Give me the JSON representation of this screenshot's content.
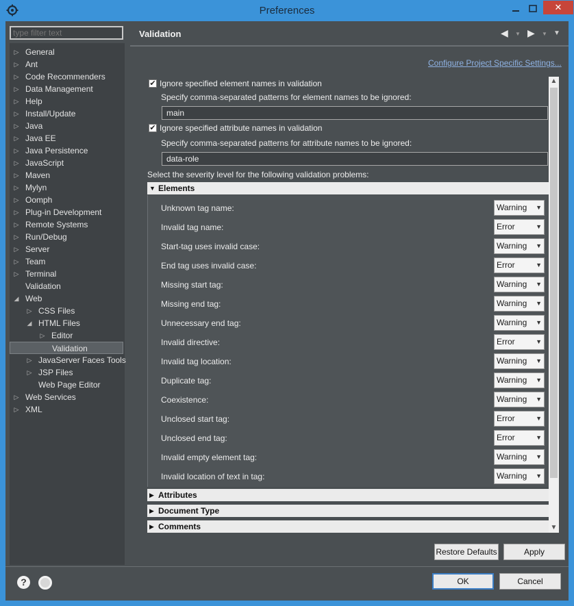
{
  "window": {
    "title": "Preferences",
    "close_glyph": "✕"
  },
  "filter": {
    "placeholder": "type filter text"
  },
  "tree": [
    {
      "label": "General",
      "depth": 0,
      "arrow": "collapsed"
    },
    {
      "label": "Ant",
      "depth": 0,
      "arrow": "collapsed"
    },
    {
      "label": "Code Recommenders",
      "depth": 0,
      "arrow": "collapsed"
    },
    {
      "label": "Data Management",
      "depth": 0,
      "arrow": "collapsed"
    },
    {
      "label": "Help",
      "depth": 0,
      "arrow": "collapsed"
    },
    {
      "label": "Install/Update",
      "depth": 0,
      "arrow": "collapsed"
    },
    {
      "label": "Java",
      "depth": 0,
      "arrow": "collapsed"
    },
    {
      "label": "Java EE",
      "depth": 0,
      "arrow": "collapsed"
    },
    {
      "label": "Java Persistence",
      "depth": 0,
      "arrow": "collapsed"
    },
    {
      "label": "JavaScript",
      "depth": 0,
      "arrow": "collapsed"
    },
    {
      "label": "Maven",
      "depth": 0,
      "arrow": "collapsed"
    },
    {
      "label": "Mylyn",
      "depth": 0,
      "arrow": "collapsed"
    },
    {
      "label": "Oomph",
      "depth": 0,
      "arrow": "collapsed"
    },
    {
      "label": "Plug-in Development",
      "depth": 0,
      "arrow": "collapsed"
    },
    {
      "label": "Remote Systems",
      "depth": 0,
      "arrow": "collapsed"
    },
    {
      "label": "Run/Debug",
      "depth": 0,
      "arrow": "collapsed"
    },
    {
      "label": "Server",
      "depth": 0,
      "arrow": "collapsed"
    },
    {
      "label": "Team",
      "depth": 0,
      "arrow": "collapsed"
    },
    {
      "label": "Terminal",
      "depth": 0,
      "arrow": "collapsed"
    },
    {
      "label": "Validation",
      "depth": 0,
      "arrow": "none"
    },
    {
      "label": "Web",
      "depth": 0,
      "arrow": "expanded"
    },
    {
      "label": "CSS Files",
      "depth": 1,
      "arrow": "collapsed"
    },
    {
      "label": "HTML Files",
      "depth": 1,
      "arrow": "expanded"
    },
    {
      "label": "Editor",
      "depth": 2,
      "arrow": "collapsed"
    },
    {
      "label": "Validation",
      "depth": 2,
      "arrow": "none",
      "selected": true
    },
    {
      "label": "JavaServer Faces Tools",
      "depth": 1,
      "arrow": "collapsed"
    },
    {
      "label": "JSP Files",
      "depth": 1,
      "arrow": "collapsed"
    },
    {
      "label": "Web Page Editor",
      "depth": 1,
      "arrow": "none"
    },
    {
      "label": "Web Services",
      "depth": 0,
      "arrow": "collapsed"
    },
    {
      "label": "XML",
      "depth": 0,
      "arrow": "collapsed"
    }
  ],
  "page": {
    "title": "Validation",
    "config_link": "Configure Project Specific Settings...",
    "ignore_elements": {
      "checked": true,
      "label": "Ignore specified element names in validation",
      "desc": "Specify comma-separated patterns for element names to be ignored:",
      "value": "main"
    },
    "ignore_attributes": {
      "checked": true,
      "label": "Ignore specified attribute names in validation",
      "desc": "Specify comma-separated patterns for attribute names to be ignored:",
      "value": "data-role"
    },
    "severity_intro": "Select the severity level for the following validation problems:",
    "sections": {
      "elements": "Elements",
      "attributes": "Attributes",
      "document_type": "Document Type",
      "comments": "Comments"
    },
    "element_rules": [
      {
        "label": "Unknown tag name:",
        "value": "Warning"
      },
      {
        "label": "Invalid tag name:",
        "value": "Error"
      },
      {
        "label": "Start-tag uses invalid case:",
        "value": "Warning"
      },
      {
        "label": "End tag uses invalid case:",
        "value": "Error"
      },
      {
        "label": "Missing start tag:",
        "value": "Warning"
      },
      {
        "label": "Missing end tag:",
        "value": "Warning"
      },
      {
        "label": "Unnecessary end tag:",
        "value": "Warning"
      },
      {
        "label": "Invalid directive:",
        "value": "Error"
      },
      {
        "label": "Invalid tag location:",
        "value": "Warning"
      },
      {
        "label": "Duplicate tag:",
        "value": "Warning"
      },
      {
        "label": "Coexistence:",
        "value": "Warning"
      },
      {
        "label": "Unclosed start tag:",
        "value": "Error"
      },
      {
        "label": "Unclosed end tag:",
        "value": "Error"
      },
      {
        "label": "Invalid empty element tag:",
        "value": "Warning"
      },
      {
        "label": "Invalid location of text in tag:",
        "value": "Warning"
      }
    ]
  },
  "buttons": {
    "restore_defaults": "Restore Defaults",
    "apply": "Apply",
    "ok": "OK",
    "cancel": "Cancel",
    "help": "?"
  }
}
